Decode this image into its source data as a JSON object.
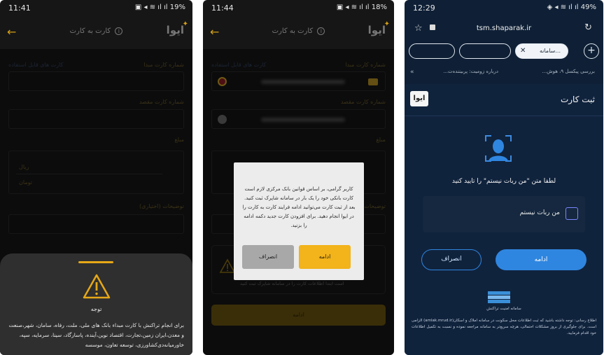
{
  "phone1": {
    "status_time": "11:41",
    "status_battery": "19%",
    "app_title": "کارت به کارت",
    "logo_text": "ایوا",
    "source_card_label": "شماره کارت مبدا",
    "usable_cards_link": "کارت های قابل استفاده",
    "dest_card_label": "شماره کارت مقصد",
    "amount_label": "مبلغ",
    "amount_rial": "ریال",
    "amount_toman": "تومان",
    "description_label": "توضیحات (اختیاری)",
    "sheet_title": "توجه",
    "sheet_body": "برای انجام تراکنش با کارت مبداء بانک های ملی، ملت، رفاه، سامان، شهر،صنعت و معدن،ایران زمین،تجارت، اقتصاد نوین،آینده، پاسارگاد، سینا، سرمایه، سپه، خاورمیانه‌دی‌کشاورزی، توسعه تعاون، موسسه"
  },
  "phone2": {
    "status_time": "11:44",
    "status_battery": "18%",
    "app_title": "کارت به کارت",
    "logo_text": "ایوا",
    "source_card_label": "شماره کارت مبدا",
    "usable_cards_link": "کارت های قابل استفاده",
    "dest_card_label": "شماره کارت مقصد",
    "amount_label": "مبلغ",
    "description_label": "توضیحات",
    "info_text": "است ابتدا اطلاعات کارت را در سامانه شاپرک ثبت کنید",
    "bottom_button": "ادامه",
    "dialog_message": "کاربر گرامی، بر اساس قوانین بانک مرکزی لازم است کارت بانکی خود را یک بار در سامانه شاپرک ثبت کنید. بعد از ثبت کارت می‌توانید ادامه فرایند کارت به کارت را در ایوا انجام دهید. برای افزودن کارت جدید دکمه ادامه را بزنید.",
    "dialog_ok": "ادامه",
    "dialog_cancel": "انصراف"
  },
  "phone3": {
    "status_time": "12:29",
    "status_battery": "49%",
    "url": "tsm.shaparak.ir",
    "active_tab_label": "سامانه...",
    "bookmark_1": "بررسی پیکسل ۹، هوش...",
    "bookmark_2": "درباره زومیت: پربیننده‌ت...",
    "page_title": "ثبت کارت",
    "logo_text": "ایوا",
    "prompt": "لطفا متن \"من ربات نیستم\" را تایید کنید",
    "captcha_label": "من ربات نیستم",
    "continue_button": "ادامه",
    "cancel_button": "انصراف",
    "shaparak_caption": "سامانه امنیت تراکنش",
    "notice": "اطلاع رسانی: توجه داشته باشید که ثبت اطلاعات محل سکونت در سامانه املاک و اسکان(amlak.mrud.ir) الزامی است. برای جلوگیری از بروز مشکلات احتمالی، هرچه سریع‌تر به سامانه مراجعه نموده و نسبت به تکمیل اطلاعات خود اقدام فرمایید."
  },
  "colors": {
    "accent_gold": "#f2b31b",
    "accent_blue": "#2f86e0",
    "dark_bg": "#161616",
    "navy_bg": "#10233d"
  }
}
